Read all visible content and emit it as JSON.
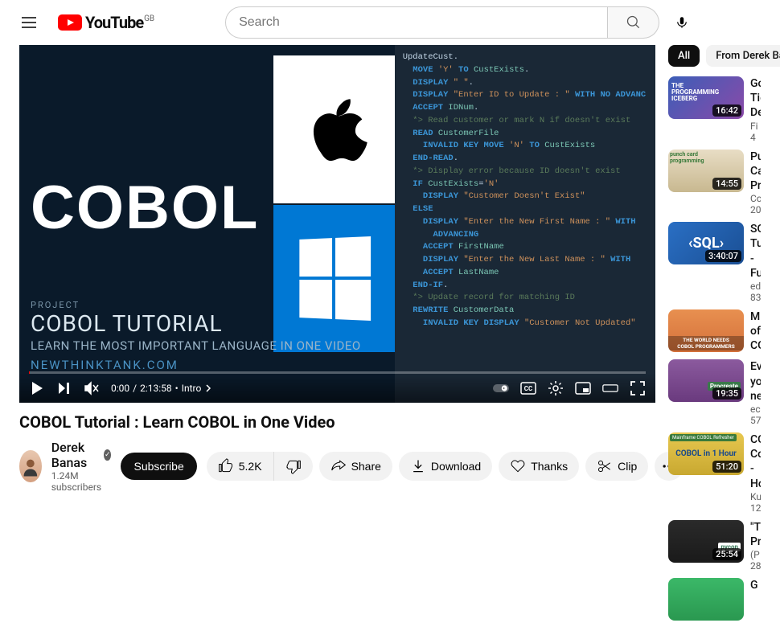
{
  "header": {
    "logo_text": "YouTube",
    "region": "GB",
    "search_placeholder": "Search"
  },
  "player": {
    "cobol_text": "COBOL",
    "project_label": "PROJECT",
    "overlay_title": "COBOL TUTORIAL",
    "overlay_subtitle": "LEARN THE MOST IMPORTANT LANGUAGE IN ONE VIDEO",
    "overlay_url": "NEWTHINKTANK.COM",
    "code_section": "UpdateCust.",
    "time_current": "0:00",
    "time_total": "2:13:58",
    "chapter_label": "Intro"
  },
  "video": {
    "title": "COBOL Tutorial : Learn COBOL in One Video",
    "channel_name": "Derek Banas",
    "subscribers": "1.24M subscribers",
    "subscribe_label": "Subscribe",
    "likes": "5.2K",
    "share_label": "Share",
    "download_label": "Download",
    "thanks_label": "Thanks",
    "clip_label": "Clip"
  },
  "chips": {
    "all": "All",
    "from": "From Derek Banas"
  },
  "recs": [
    {
      "title": "God-Tier Developer",
      "ch": "Fi",
      "views": "4",
      "dur": "16:42",
      "thumb": "t1",
      "txt": "THE PROGRAMMING ICEBERG"
    },
    {
      "title": "Punched Card Programming",
      "ch": "Co",
      "views": "20",
      "dur": "14:55",
      "thumb": "t2",
      "txt": "punch card programming"
    },
    {
      "title": "SQL Tutorial - Full",
      "ch": "ed",
      "views": "83",
      "dur": "3:40:07",
      "thumb": "t3",
      "txt": "SQL"
    },
    {
      "title": "Millions of COBOL",
      "ch": "",
      "views": "",
      "dur": "",
      "thumb": "t4",
      "txt": "COBOL PROGRAMMERS"
    },
    {
      "title": "Everything you need",
      "ch": "ec",
      "views": "57",
      "dur": "19:35",
      "thumb": "t5",
      "txt": "Procreate"
    },
    {
      "title": "COBOL Course - How",
      "ch": "Ku",
      "views": "12",
      "dur": "51:20",
      "thumb": "t6",
      "txt": "COBOL in 1 Hour"
    },
    {
      "title": "\"The Programming\"",
      "ch": "(P",
      "views": "28",
      "dur": "25:54",
      "thumb": "t7",
      "txt": "pycon"
    },
    {
      "title": "G",
      "ch": "",
      "views": "",
      "dur": "",
      "thumb": "t8",
      "txt": ""
    }
  ]
}
